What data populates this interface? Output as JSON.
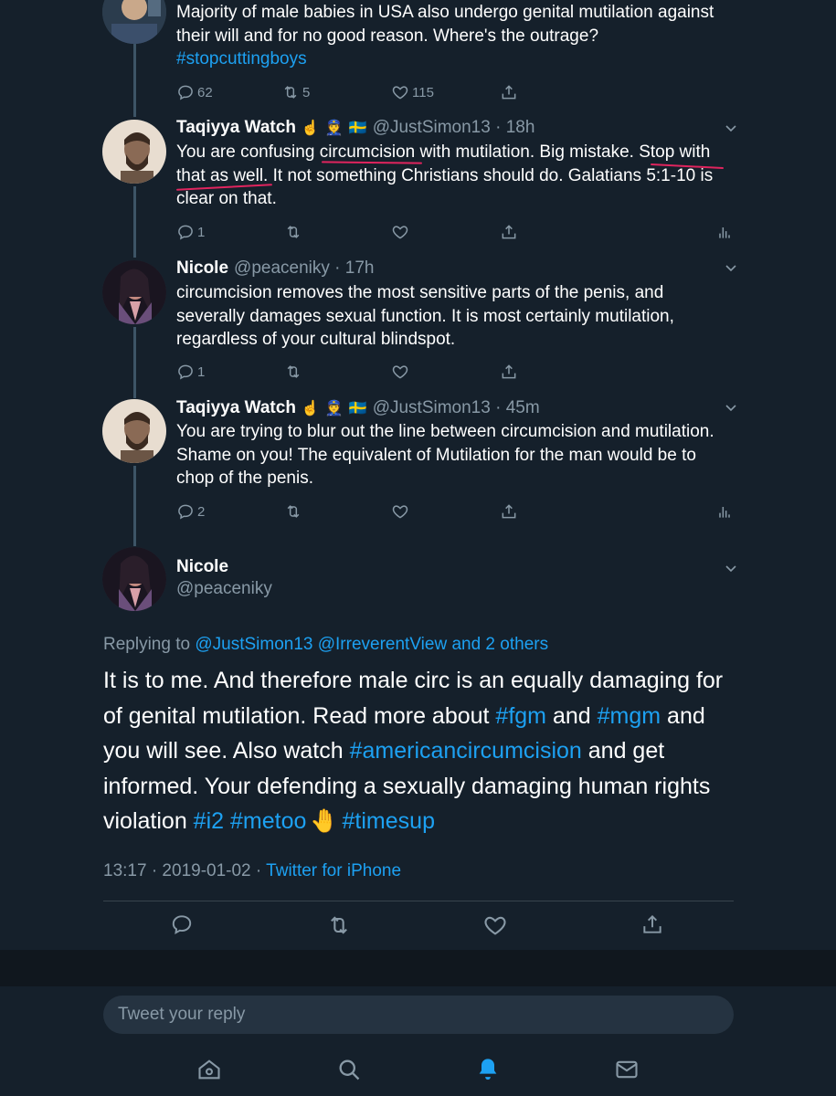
{
  "tweets": [
    {
      "text_lines": [
        "Majority of male babies in USA also undergo genital mutilation against",
        "their will and for no good reason. Where's the outrage?"
      ],
      "hashtag": "#stopcuttingboys",
      "replies": "62",
      "retweets": "5",
      "likes": "115"
    },
    {
      "name": "Taqiyya Watch",
      "emojis": [
        "☝️",
        "👮",
        "🇸🇪"
      ],
      "handle": "@JustSimon13 · 18h",
      "text_lines": [
        "You are confusing circumcision with mutilation. Big mistake. Stop with",
        "that as well. It not something Christians should do. Galatians 5:1-10 is",
        "clear on that."
      ],
      "replies": "1"
    },
    {
      "name": "Nicole",
      "handle": "@peaceniky · 17h",
      "text_lines": [
        "circumcision removes the most sensitive parts of the penis, and",
        "severally damages sexual function. It is most certainly mutilation,",
        "regardless of your cultural blindspot."
      ],
      "replies": "1"
    },
    {
      "name": "Taqiyya Watch",
      "emojis": [
        "☝️",
        "👮",
        "🇸🇪"
      ],
      "handle": "@JustSimon13 · 45m",
      "text_lines": [
        "You are trying to blur out the line between circumcision and mutilation.",
        "Shame on you! The equivalent of Mutilation for the man would be to",
        "chop of the penis."
      ],
      "replies": "2"
    }
  ],
  "main_tweet": {
    "name": "Nicole",
    "handle": "@peaceniky",
    "replying_prefix": "Replying to",
    "replying_to": "@JustSimon13 @IrreverentView and 2 others",
    "line1": "It is to me. And therefore male circ is an equally damaging for",
    "line2_a": "of genital mutilation. Read more about ",
    "tag_fgm": "#fgm",
    "line2_b": " and ",
    "tag_mgm": "#mgm",
    "line2_c": " and",
    "line3_a": "you will see. Also watch ",
    "tag_ac": "#americancircumcision",
    "line3_b": " and get",
    "line4": "informed. Your defending a sexually damaging human rights",
    "line5_a": "violation ",
    "tag_i2": "#i2",
    "tag_metoo": "#metoo",
    "emoji_hand": "🤚",
    "tag_timesup": "#timesup",
    "timestamp": "13:17 · 2019-01-02 · ",
    "client": "Twitter for iPhone"
  },
  "reply_box": {
    "placeholder": "Tweet your reply"
  },
  "colors": {
    "background": "#15202b",
    "accent": "#1da1f2",
    "muted": "#8899a6",
    "underline": "#e0245e"
  },
  "tabbar": [
    "home-icon",
    "search-icon",
    "notifications-icon",
    "messages-icon"
  ]
}
